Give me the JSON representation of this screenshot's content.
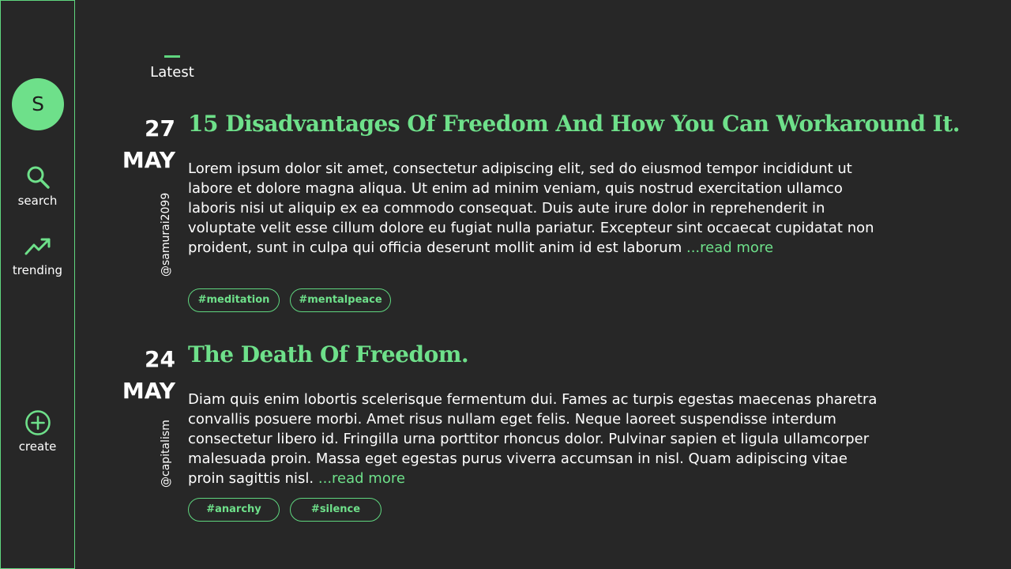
{
  "sidebar": {
    "avatar_letter": "S",
    "items": [
      {
        "label": "search",
        "icon": "search-icon"
      },
      {
        "label": "trending",
        "icon": "trending-up-icon"
      },
      {
        "label": "create",
        "icon": "plus-circle-icon"
      }
    ]
  },
  "tabs": {
    "active_label": "Latest"
  },
  "posts": [
    {
      "day": "27",
      "month": "MAY",
      "author": "@samurai2099",
      "title": "15 Disadvantages Of Freedom And How You Can Workaround It.",
      "body": "Lorem ipsum dolor sit amet, consectetur adipiscing elit, sed do eiusmod tempor incididunt ut labore et dolore magna aliqua. Ut enim ad minim veniam, quis nostrud exercitation ullamco laboris nisi ut aliquip ex ea commodo consequat. Duis aute irure dolor in reprehenderit in voluptate velit esse cillum dolore eu fugiat nulla pariatur. Excepteur sint occaecat cupidatat non proident, sunt in culpa qui officia deserunt mollit anim id est laborum",
      "read_more": "...read more",
      "tags": [
        "#meditation",
        "#mentalpeace"
      ]
    },
    {
      "day": "24",
      "month": "MAY",
      "author": "@capitalism",
      "title": "The Death Of Freedom.",
      "body": "Diam quis enim lobortis scelerisque fermentum dui. Fames ac turpis egestas maecenas pharetra convallis posuere morbi. Amet risus nullam eget felis. Neque laoreet suspendisse interdum consectetur libero id. Fringilla urna porttitor rhoncus dolor. Pulvinar sapien et ligula ullamcorper malesuada proin. Massa eget egestas purus viverra accumsan in nisl. Quam adipiscing vitae proin sagittis nisl.",
      "read_more": "...read more",
      "tags": [
        "#anarchy",
        "#silence"
      ]
    }
  ],
  "colors": {
    "accent": "#6ee08a",
    "background": "#272727",
    "text": "#ffffff"
  }
}
